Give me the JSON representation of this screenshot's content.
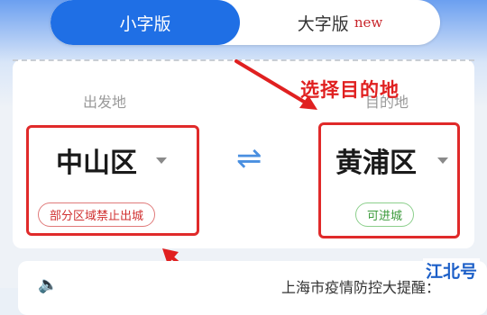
{
  "tabs": {
    "small_label": "小字版",
    "large_label": "大字版",
    "large_badge": "new"
  },
  "annotation": {
    "hint": "选择目的地"
  },
  "route": {
    "origin_label": "出发地",
    "dest_label": "目的地",
    "origin_district": "中山区",
    "dest_district": "黄浦区",
    "origin_status": "部分区域禁止出城",
    "dest_status": "可进城",
    "swap_symbol": "⇌"
  },
  "notice": {
    "text": "上海市疫情防控大提醒："
  },
  "watermark": "江北号",
  "colors": {
    "primary": "#1f6fe5",
    "annotation_red": "#e02020",
    "status_red": "#d03030",
    "status_green": "#3b9a3b"
  }
}
